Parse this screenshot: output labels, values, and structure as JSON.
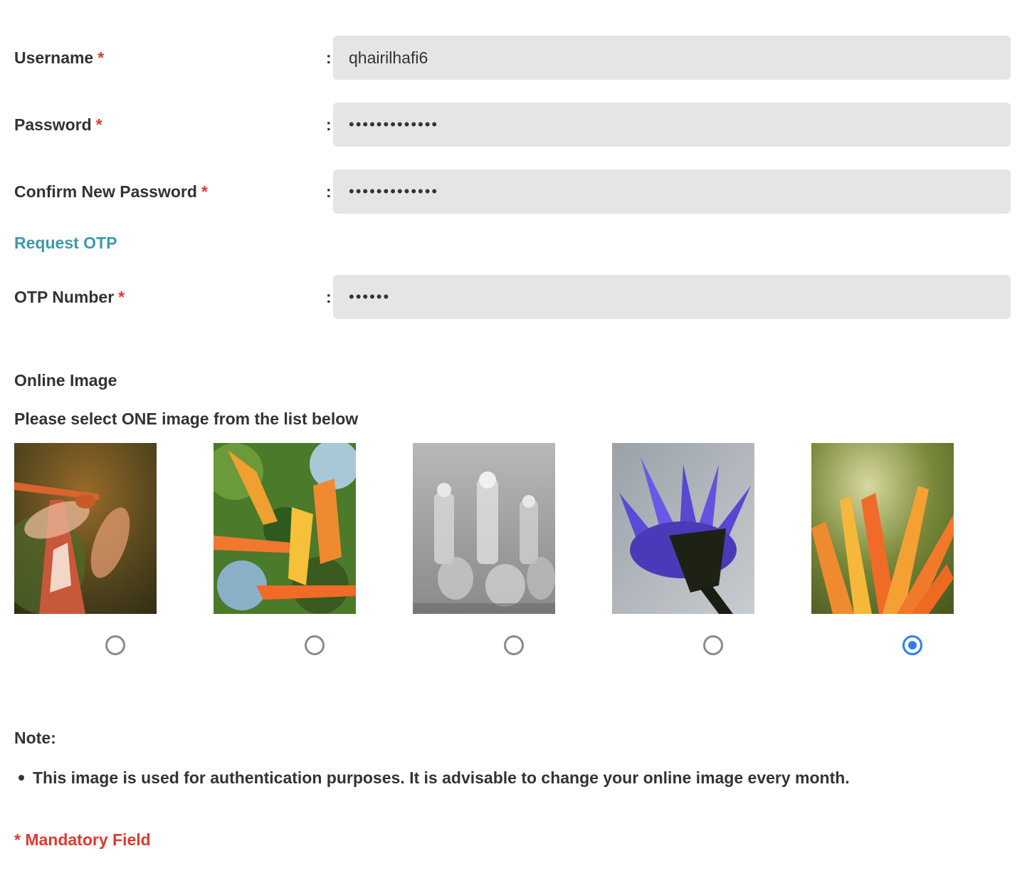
{
  "form": {
    "username": {
      "label": "Username",
      "required_mark": "*",
      "colon": ":",
      "value": "qhairilhafi6"
    },
    "password": {
      "label": "Password",
      "required_mark": "*",
      "colon": ":",
      "value": "•••••••••••••"
    },
    "confirm_password": {
      "label": "Confirm New Password",
      "required_mark": "*",
      "colon": ":",
      "value": "•••••••••••••"
    },
    "request_otp_link": "Request OTP",
    "otp": {
      "label": "OTP Number",
      "required_mark": "*",
      "colon": ":",
      "value": "••••••"
    }
  },
  "online_image": {
    "title": "Online Image",
    "instruction": "Please select ONE image from the list below",
    "options": [
      {
        "icon": "dragonfly-image",
        "selected": false
      },
      {
        "icon": "bird-of-paradise-flower-image",
        "selected": false
      },
      {
        "icon": "glass-chess-pieces-image",
        "selected": false
      },
      {
        "icon": "purple-lotus-flower-image",
        "selected": false
      },
      {
        "icon": "orange-heliconia-flower-image",
        "selected": true
      }
    ]
  },
  "note": {
    "title": "Note:",
    "items": [
      "This image is used for authentication purposes. It is advisable to change your online image every month."
    ]
  },
  "mandatory_field": "* Mandatory Field",
  "colors": {
    "required": "#e03a2f",
    "link": "#3e9aa8",
    "field_bg": "#e5e5e5",
    "radio_selected": "#2f7cf6",
    "radio_unselected": "#8a8a92",
    "text": "#333333"
  }
}
